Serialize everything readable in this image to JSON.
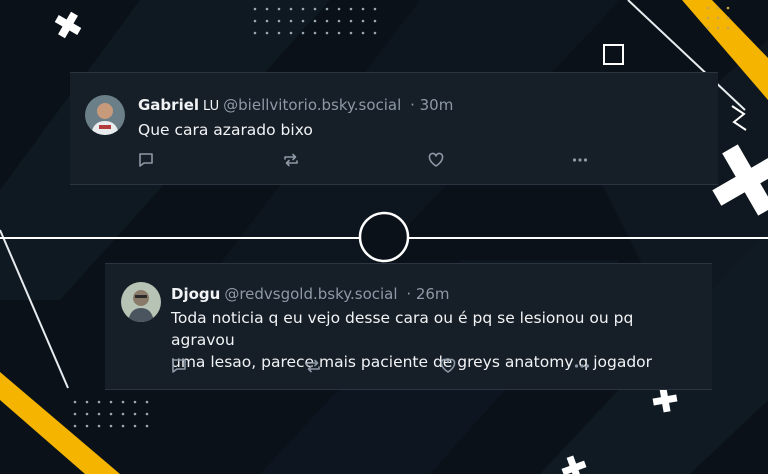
{
  "posts": [
    {
      "display_name": "Gabriel",
      "display_suffix": "LU",
      "handle": "@biellvitorio.bsky.social",
      "time": "· 30m",
      "text": "Que cara azarado bixo"
    },
    {
      "display_name": "Djogu",
      "handle": "@redvsgold.bsky.social",
      "time": "· 26m",
      "text_lines": [
        "Toda noticia q eu vejo desse cara ou é pq se lesionou ou pq agravou",
        "uma lesao, parece mais paciente de greys anatomy q jogador"
      ]
    }
  ],
  "icons": {
    "reply": "reply-icon",
    "repost": "repost-icon",
    "like": "heart-icon",
    "more": "more-icon"
  },
  "colors": {
    "background": "#0a1118",
    "card": "#161e27",
    "accent_yellow": "#f5b400",
    "text": "#f1f3f5",
    "muted": "#8d99a7"
  }
}
